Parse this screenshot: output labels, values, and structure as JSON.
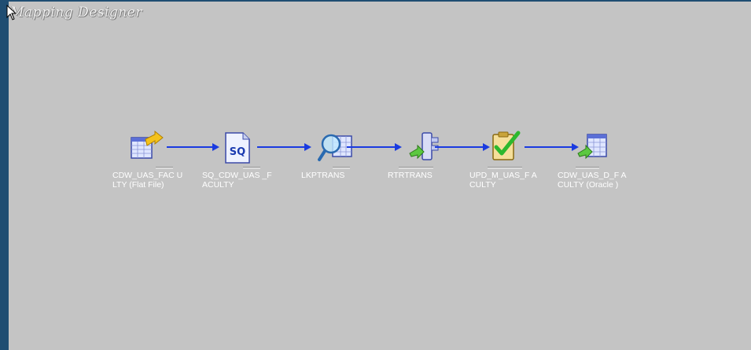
{
  "window": {
    "title": "Mapping Designer"
  },
  "colors": {
    "canvas": "#c4c4c4",
    "frame": "#1f4d72",
    "link": "#1a3be0"
  },
  "transformations": [
    {
      "label": "CDW_UAS_FAC ULTY (Flat File)",
      "icon": "flat-file-source-icon"
    },
    {
      "label": "SQ_CDW_UAS _FACULTY",
      "icon": "source-qualifier-icon"
    },
    {
      "label": "LKPTRANS",
      "icon": "lookup-icon"
    },
    {
      "label": "RTRTRANS",
      "icon": "router-icon"
    },
    {
      "label": "UPD_M_UAS_F ACULTY",
      "icon": "update-strategy-icon"
    },
    {
      "label": "CDW_UAS_D_F ACULTY (Oracle )",
      "icon": "oracle-target-icon"
    }
  ]
}
